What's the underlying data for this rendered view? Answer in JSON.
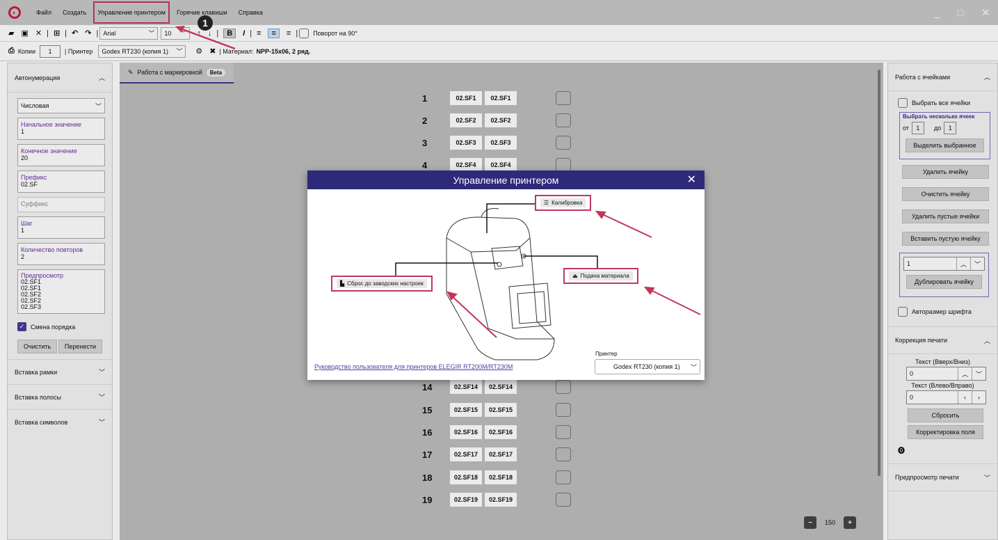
{
  "app": {
    "menu": [
      "Файл",
      "Создать",
      "Управление принтером",
      "Горячие клавиши",
      "Справка"
    ],
    "window_controls": [
      "_",
      "□",
      "✕"
    ]
  },
  "toolbar1": {
    "font": "Arial",
    "font_size": "10",
    "rotate_label": "Поворот на 90°"
  },
  "toolbar2": {
    "copies_label": "Копии",
    "copies_value": "1",
    "printer_label": "| Принтер",
    "printer_value": "Godex RT230 (копия 1)",
    "material_label": "| Материал:",
    "material_value": "NPP-15x06, 2 ряд."
  },
  "left": {
    "title": "Автонумерация",
    "type": "Числовая",
    "fields": [
      {
        "label": "Начальное значение",
        "value": "1"
      },
      {
        "label": "Конечное значение",
        "value": "20"
      },
      {
        "label": "Префикс",
        "value": "02.SF"
      },
      {
        "label": "Суффикс",
        "value": ""
      },
      {
        "label": "Шаг",
        "value": "1"
      },
      {
        "label": "Количество повторов",
        "value": "2"
      }
    ],
    "preview_label": "Предпросмотр",
    "preview_lines": [
      "02.SF1",
      "02.SF1",
      "02.SF2",
      "02.SF2",
      "02.SF3"
    ],
    "order_label": "Смена порядка",
    "clear_btn": "Очистить",
    "move_btn": "Перенести",
    "sections": [
      "Вставка рамки",
      "Вставка полосы",
      "Вставка символов"
    ]
  },
  "center": {
    "tab_label": "Работа с маркировкой",
    "beta": "Beta",
    "rows": [
      {
        "n": "1",
        "a": "02.SF1",
        "b": "02.SF1"
      },
      {
        "n": "2",
        "a": "02.SF2",
        "b": "02.SF2"
      },
      {
        "n": "3",
        "a": "02.SF3",
        "b": "02.SF3"
      },
      {
        "n": "4",
        "a": "02.SF4",
        "b": "02.SF4"
      },
      {
        "n": "14",
        "a": "02.SF14",
        "b": "02.SF14"
      },
      {
        "n": "15",
        "a": "02.SF15",
        "b": "02.SF15"
      },
      {
        "n": "16",
        "a": "02.SF16",
        "b": "02.SF16"
      },
      {
        "n": "17",
        "a": "02.SF17",
        "b": "02.SF17"
      },
      {
        "n": "18",
        "a": "02.SF18",
        "b": "02.SF18"
      },
      {
        "n": "19",
        "a": "02.SF19",
        "b": "02.SF19"
      }
    ],
    "zoom": "150"
  },
  "right": {
    "title": "Работа с ячейками",
    "select_all": "Выбрать все ячейки",
    "select_multi": "Выбрать несколько ячеек",
    "from_label": "от",
    "from_value": "1",
    "to_label": "до",
    "to_value": "1",
    "select_btn": "Выделить выбранное",
    "buttons": [
      "Удалить ячейку",
      "Очистить ячейку",
      "Удалить пустые ячейки",
      "Вставить пустую ячейку"
    ],
    "dup_value": "1",
    "dup_btn": "Дублировать ячейку",
    "autosize": "Авторазмер шрифта",
    "correction_title": "Коррекция печати",
    "text_vert": "Текст (Вверх/Вниз)",
    "text_vert_value": "0",
    "text_horiz": "Текст (Влево/Вправо)",
    "text_horiz_value": "0",
    "reset_btn": "Сбросить",
    "field_corr_btn": "Корректировка поля",
    "preview_title": "Предпросмотр печати"
  },
  "modal": {
    "title": "Управление принтером",
    "calibrate": "Калибровка",
    "reset": "Сброс до заводских настроек",
    "feed": "Подача материала",
    "manual_link": "Руководство пользователя для принтеров ELEGIR RT200M/RT230M",
    "printer_label": "Принтер",
    "printer_value": "Godex RT230 (копия 1)"
  },
  "annotation": {
    "badge": "1",
    "color": "#c0375a"
  }
}
